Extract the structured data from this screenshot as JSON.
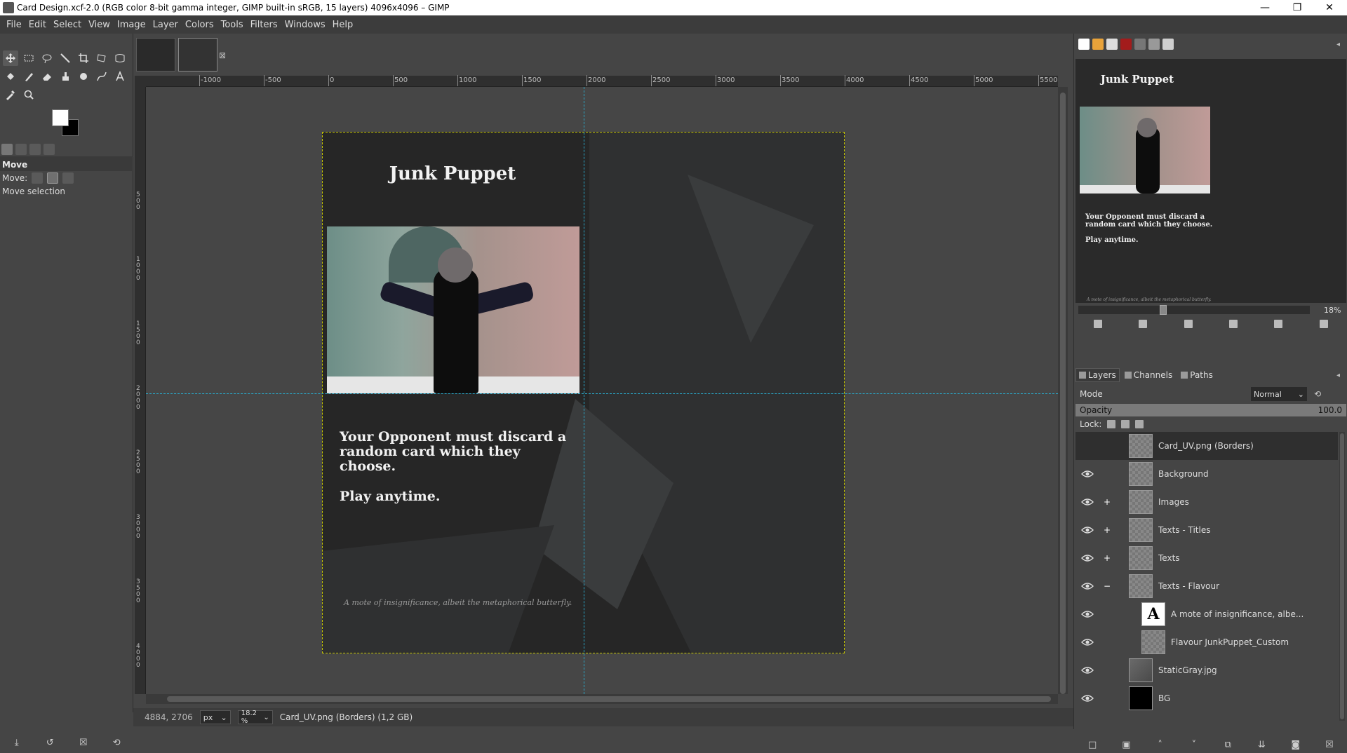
{
  "window": {
    "title": "Card Design.xcf-2.0 (RGB color 8-bit gamma integer, GIMP built-in sRGB, 15 layers) 4096x4096 – GIMP"
  },
  "menu": [
    "File",
    "Edit",
    "Select",
    "View",
    "Image",
    "Layer",
    "Colors",
    "Tools",
    "Filters",
    "Windows",
    "Help"
  ],
  "tool_options": {
    "title": "Move",
    "move_label": "Move:",
    "mode_text": "Move selection"
  },
  "ruler_ticks": [
    "-1000",
    "-500",
    "0",
    "500",
    "1000",
    "1500",
    "2000",
    "2500",
    "3000",
    "3500",
    "4000",
    "4500",
    "5000",
    "5500"
  ],
  "vruler_ticks": [
    "500",
    "1000",
    "1500",
    "2000",
    "2500",
    "3000",
    "3500",
    "4000"
  ],
  "card": {
    "title": "Junk Puppet",
    "rules_1": "Your Opponent must discard a random card which they choose.",
    "rules_2": "Play anytime.",
    "flavour": "A mote of insignificance, albeit the metaphorical butterfly."
  },
  "status": {
    "coords": "4884, 2706",
    "unit": "px",
    "zoom": "18.2 %",
    "layer_info": "Card_UV.png (Borders) (1,2 GB)"
  },
  "navigator": {
    "zoom": "18%"
  },
  "layer_panel": {
    "tabs": [
      "Layers",
      "Channels",
      "Paths"
    ],
    "mode_label": "Mode",
    "mode_value": "Normal",
    "opacity_label": "Opacity",
    "opacity_value": "100.0",
    "lock_label": "Lock:"
  },
  "layers": [
    {
      "name": "Card_UV.png (Borders)",
      "visible": false,
      "indent": 0,
      "expander": "",
      "thumb": "checker",
      "selected": true
    },
    {
      "name": "Background",
      "visible": true,
      "indent": 0,
      "expander": "",
      "thumb": "checker"
    },
    {
      "name": "Images",
      "visible": true,
      "indent": 0,
      "expander": "+",
      "thumb": "checker"
    },
    {
      "name": "Texts - Titles",
      "visible": true,
      "indent": 0,
      "expander": "+",
      "thumb": "checker"
    },
    {
      "name": "Texts",
      "visible": true,
      "indent": 0,
      "expander": "+",
      "thumb": "checker"
    },
    {
      "name": "Texts - Flavour",
      "visible": true,
      "indent": 0,
      "expander": "−",
      "thumb": "checker"
    },
    {
      "name": "A mote of insignificance, albe...",
      "visible": true,
      "indent": 1,
      "expander": "",
      "thumb": "text"
    },
    {
      "name": "Flavour JunkPuppet_Custom",
      "visible": true,
      "indent": 1,
      "expander": "",
      "thumb": "checker"
    },
    {
      "name": "StaticGray.jpg",
      "visible": true,
      "indent": 0,
      "expander": "",
      "thumb": "gray"
    },
    {
      "name": "BG",
      "visible": true,
      "indent": 0,
      "expander": "",
      "thumb": "dark"
    }
  ],
  "colors": {
    "guide": "#2aa6c7",
    "card_border": "#c8c800"
  }
}
